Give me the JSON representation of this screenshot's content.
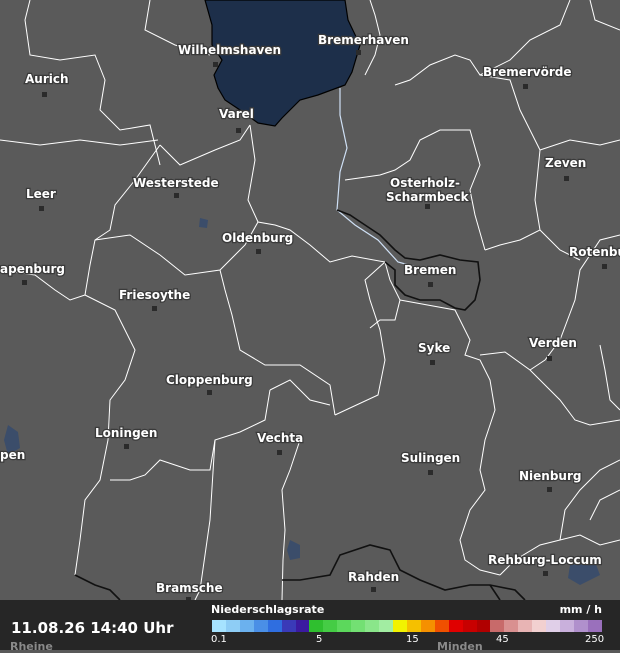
{
  "map": {
    "cities": [
      {
        "name": "Wilhelmshaven"
      },
      {
        "name": "Bremerhaven"
      },
      {
        "name": "Aurich"
      },
      {
        "name": "Bremervörde"
      },
      {
        "name": "Varel"
      },
      {
        "name": "Zeven"
      },
      {
        "name": "Westerstede"
      },
      {
        "name": "Osterholz-"
      },
      {
        "name": "Scharmbeck"
      },
      {
        "name": "Leer"
      },
      {
        "name": "Oldenburg"
      },
      {
        "name": "Rotenbu"
      },
      {
        "name": "Bremen"
      },
      {
        "name": "apenburg"
      },
      {
        "name": "Friesoythe"
      },
      {
        "name": "Syke"
      },
      {
        "name": "Verden"
      },
      {
        "name": "Cloppenburg"
      },
      {
        "name": "Loningen"
      },
      {
        "name": "Vechta"
      },
      {
        "name": "pen"
      },
      {
        "name": "Sulingen"
      },
      {
        "name": "Nienburg"
      },
      {
        "name": "Rehburg-Loccum"
      },
      {
        "name": "Rahden"
      },
      {
        "name": "Bramsche"
      },
      {
        "name": "Rheine"
      },
      {
        "name": "Minden"
      }
    ]
  },
  "footer": {
    "timestamp": "11.08.26 14:40 Uhr",
    "legend_title": "Niederschlagsrate",
    "legend_unit": "mm / h",
    "ticks": [
      "0.1",
      "5",
      "15",
      "45",
      "250"
    ],
    "colors": [
      "#a6e3ff",
      "#8ecdf5",
      "#6bb1ee",
      "#4a8fe6",
      "#2f6ee0",
      "#3a3ab8",
      "#3b1aa0",
      "#2fbf2f",
      "#45cc45",
      "#5cd85c",
      "#73e073",
      "#8ae68a",
      "#a2eda2",
      "#f2f200",
      "#f5c000",
      "#f59000",
      "#f05000",
      "#e00000",
      "#c80000",
      "#b00000",
      "#c86a6a",
      "#d99090",
      "#e8b4b4",
      "#f2d0d0",
      "#e0cfe8",
      "#c9b0dc",
      "#b090cc",
      "#9a70bc"
    ]
  }
}
